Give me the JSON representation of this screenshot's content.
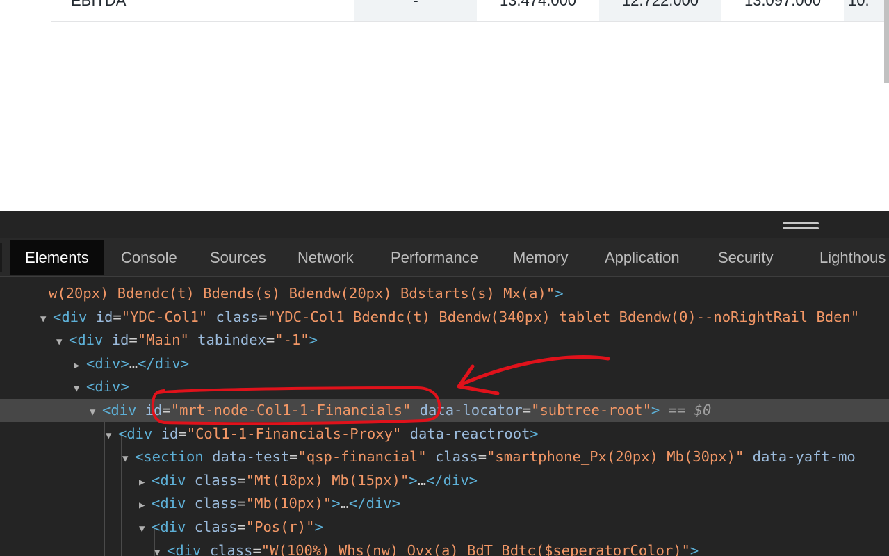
{
  "financials_row": {
    "label": "EBITDA",
    "values": [
      "-",
      "13.474.000",
      "12.722.000",
      "13.097.000",
      "10."
    ]
  },
  "devtools": {
    "tabs": [
      "Elements",
      "Console",
      "Sources",
      "Network",
      "Performance",
      "Memory",
      "Application",
      "Security",
      "Lighthous"
    ],
    "active_tab": "Elements",
    "selected_marker": "== $0",
    "dom_lines": [
      {
        "parts": [
          "w(20px) Bdendc(t) Bdends(s) Bdendw(20px) Bdstarts(s) Mx(a)\"",
          ">"
        ]
      },
      {
        "tag": "div",
        "attrs": [
          [
            "id",
            "YDC-Col1"
          ],
          [
            "class",
            "YDC-Col1 Bdendc(t) Bdendw(340px) tablet_Bdendw(0)--noRightRail Bden"
          ]
        ]
      },
      {
        "tag": "div",
        "attrs": [
          [
            "id",
            "Main"
          ],
          [
            "tabindex",
            "-1"
          ]
        ]
      },
      {
        "collapsed": "<div>…</div>"
      },
      {
        "open": "<div>"
      },
      {
        "tag": "div",
        "attrs": [
          [
            "id",
            "mrt-node-Col1-1-Financials"
          ],
          [
            "data-locator",
            "subtree-root"
          ]
        ]
      },
      {
        "tag": "div",
        "attrs": [
          [
            "id",
            "Col1-1-Financials-Proxy"
          ],
          [
            "data-reactroot",
            ""
          ]
        ]
      },
      {
        "tag": "section",
        "attrs": [
          [
            "data-test",
            "qsp-financial"
          ],
          [
            "class",
            "smartphone_Px(20px) Mb(30px)"
          ],
          [
            "data-yaft-mo",
            ""
          ]
        ]
      },
      {
        "tag": "div",
        "attrs": [
          [
            "class",
            "Mt(18px) Mb(15px)"
          ]
        ],
        "collapsed": true
      },
      {
        "tag": "div",
        "attrs": [
          [
            "class",
            "Mb(10px)"
          ]
        ],
        "collapsed": true
      },
      {
        "tag": "div",
        "attrs": [
          [
            "class",
            "Pos(r)"
          ]
        ]
      },
      {
        "tag": "div",
        "attrs": [
          [
            "class",
            "W(100%) Whs(nw) Ovx(a) BdT Bdtc($seperatorColor)"
          ]
        ]
      }
    ]
  },
  "annotation": {
    "color": "#e0121b"
  }
}
